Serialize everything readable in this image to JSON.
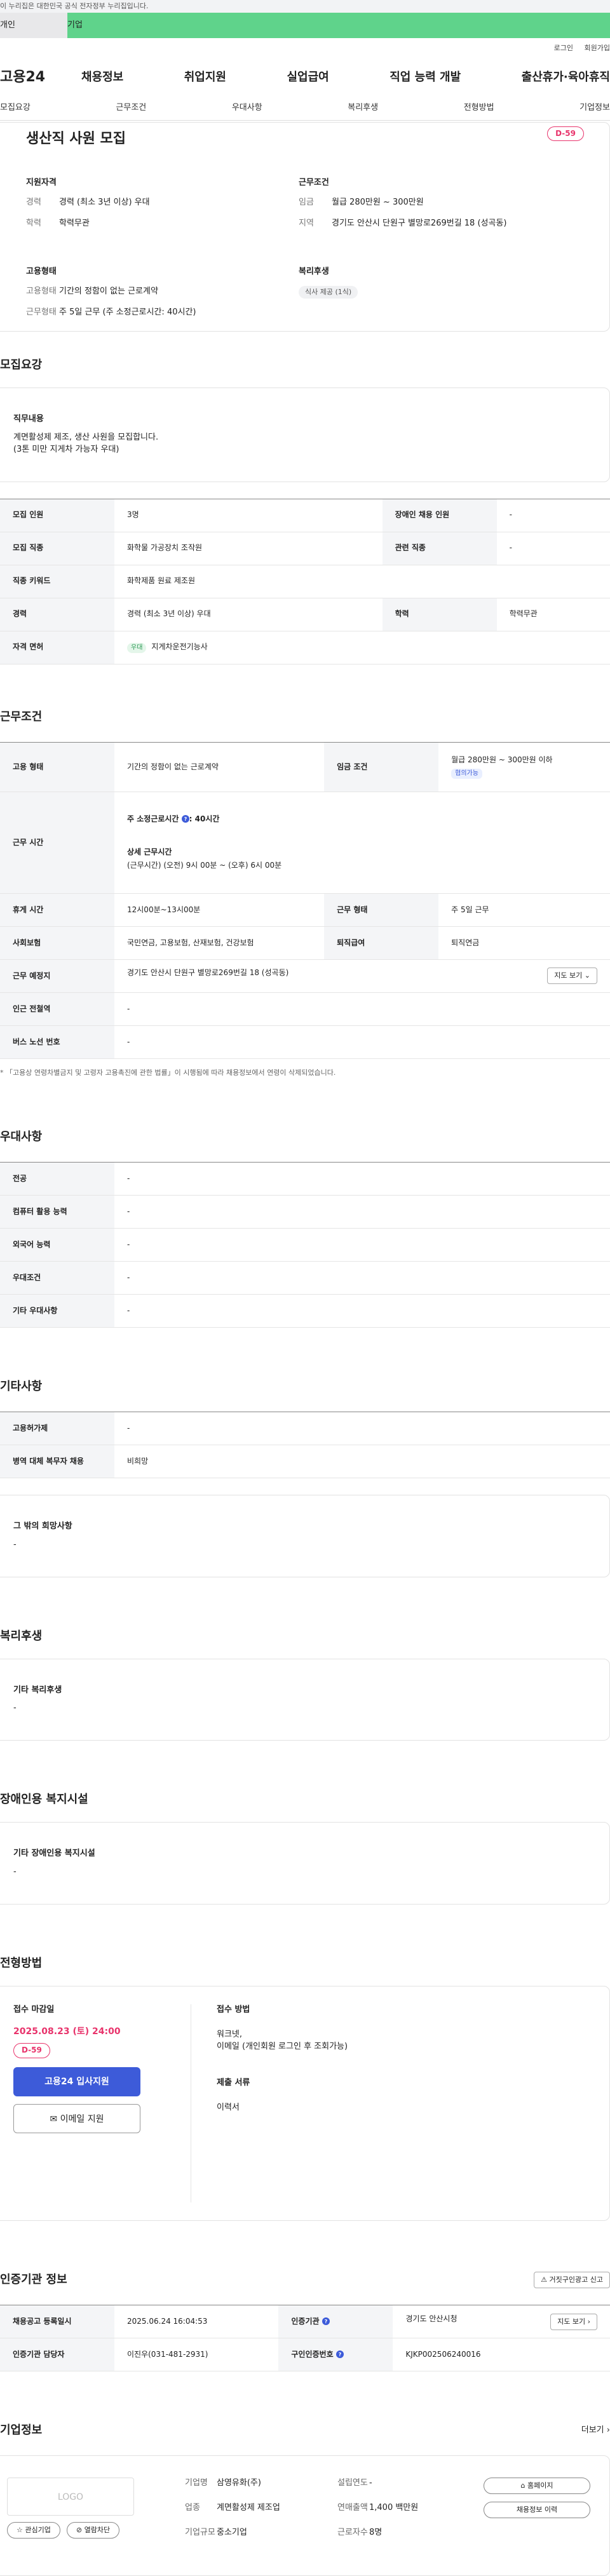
{
  "topbar": {
    "text": "이 누리집은 대한민국 공식 전자정부 누리집입니다."
  },
  "gnb_tabs": [
    "개인",
    "기업"
  ],
  "util": {
    "login": "로그인",
    "join": "회원가입"
  },
  "header": {
    "logo": "고용24",
    "nav": [
      "채용정보",
      "취업지원",
      "실업급여",
      "직업 능력 개발",
      "출산휴가·육아휴직"
    ]
  },
  "subnav": [
    "모집요강",
    "근무조건",
    "우대사항",
    "복리후생",
    "전형방법",
    "기업정보"
  ],
  "summary": {
    "title": "생산직 사원 모집",
    "dday": "D-59",
    "qual_h": "지원자격",
    "exp_k": "경력",
    "exp_v": "경력 (최소 3년 이상) 우대",
    "edu_k": "학력",
    "edu_v": "학력무관",
    "cond_h": "근무조건",
    "wage_k": "임금",
    "wage_v": "월급 280만원 ~ 300만원",
    "area_k": "지역",
    "area_v": "경기도 안산시 단원구 별망로269번길 18 (성곡동)",
    "emp_h": "고용형태",
    "emp_k1": "고용형태",
    "emp_v1": "기간의 정함이 없는 근로계약",
    "emp_k2": "근무형태",
    "emp_v2": "주 5일 근무 (주 소정근로시간: 40시간)",
    "wel_h": "복리후생",
    "wel_chip": "식사 제공 (1식)"
  },
  "recruit": {
    "section": "모집요강",
    "duty_h": "직무내용",
    "duty_1": "계면활성제 제조, 생산 사원을 모집합니다.",
    "duty_2": "(3톤 미만 지게차 가능자 우대)",
    "rows": {
      "count_k": "모집 인원",
      "count_v": "3명",
      "disab_k": "장애인 채용 인원",
      "disab_v": "-",
      "job_k": "모집 직종",
      "job_v": "화학물 가공장치 조작원",
      "rel_k": "관련 직종",
      "rel_v": "-",
      "kw_k": "직종 키워드",
      "kw_v": "화학제품 원료 제조원",
      "exp_k": "경력",
      "exp_v": "경력 (최소 3년 이상) 우대",
      "edu_k": "학력",
      "edu_v": "학력무관",
      "lic_k": "자격 면허",
      "lic_tag": "우대",
      "lic_v": "지게차운전기능사"
    }
  },
  "work": {
    "section": "근무조건",
    "type_k": "고용 형태",
    "type_v": "기간의 정함이 없는 근로계약",
    "wage_k": "임금 조건",
    "wage_v": "월급 280만원 ~ 300만원 이하",
    "wage_tag": "협의가능",
    "time_k": "근무 시간",
    "time_1": "주 소정근로시간",
    "time_1v": ": 40시간",
    "time_2": "상세 근무시간",
    "time_3": "(근무시간) (오전) 9시 00분 ~ (오후) 6시 00분",
    "rest_k": "휴게 시간",
    "rest_v": "12시00분~13시00분",
    "form_k": "근무 형태",
    "form_v": "주 5일 근무",
    "ins_k": "사회보험",
    "ins_v": "국민연금, 고용보험, 산재보험, 건강보험",
    "ret_k": "퇴직급여",
    "ret_v": "퇴직연금",
    "place_k": "근무 예정지",
    "place_v": "경기도 안산시 단원구 별망로269번길 18 (성곡동)",
    "map_btn": "지도 보기",
    "sub_k": "인근 전철역",
    "sub_v": "-",
    "bus_k": "버스 노선 번호",
    "bus_v": "-",
    "note": "* 「고용상 연령차별금지 및 고령자 고용촉진에 관한 법률」이 시행됨에 따라 채용정보에서 연령이 삭제되었습니다."
  },
  "pref": {
    "section": "우대사항",
    "rows": [
      {
        "k": "전공",
        "v": "-"
      },
      {
        "k": "컴퓨터 활용 능력",
        "v": "-"
      },
      {
        "k": "외국어 능력",
        "v": "-"
      },
      {
        "k": "우대조건",
        "v": "-"
      },
      {
        "k": "기타 우대사항",
        "v": "-"
      }
    ]
  },
  "etc": {
    "section": "기타사항",
    "rows": [
      {
        "k": "고용허가제",
        "v": "-"
      },
      {
        "k": "병역 대체 복무자 채용",
        "v": "비희망"
      }
    ],
    "wish_h": "그 밖의 희망사항",
    "wish_v": "-"
  },
  "welfare": {
    "section": "복리후생",
    "h": "기타 복리후생",
    "v": "-"
  },
  "disab": {
    "section": "장애인용 복지시설",
    "h": "기타 장애인용 복지시설",
    "v": "-"
  },
  "process": {
    "section": "전형방법",
    "dl_h": "접수 마감일",
    "dl_v": "2025.08.23 (토) 24:00",
    "dday": "D-59",
    "apply_btn": "고용24 입사지원",
    "email_btn": "이메일 지원",
    "method_h": "접수 방법",
    "method_1": "워크넷,",
    "method_2": "이메일 (개인회원 로그인 후 조회가능)",
    "doc_h": "제출 서류",
    "doc_v": "이력서"
  },
  "cert": {
    "section": "인증기관 정보",
    "report_btn": "거짓구인광고 신고",
    "reg_k": "채용공고 등록일시",
    "reg_v": "2025.06.24 16:04:53",
    "org_k": "인증기관",
    "org_v": "경기도 안산시청",
    "map_btn": "지도 보기",
    "mgr_k": "인증기관 담당자",
    "mgr_v": "이진우(031-481-2931)",
    "no_k": "구인인증번호",
    "no_v": "KJKP002506240016"
  },
  "company": {
    "section": "기업정보",
    "more": "더보기",
    "logo": "LOGO",
    "fav_btn": "관심기업",
    "block_btn": "열람차단",
    "name_k": "기업명",
    "name_v": "삼영유화(주)",
    "ind_k": "업종",
    "ind_v": "계면활성제 제조업",
    "size_k": "기업규모",
    "size_v": "중소기업",
    "year_k": "설립연도",
    "year_v": "-",
    "sales_k": "연매출액",
    "sales_v": "1,400 백만원",
    "emp_k": "근로자수",
    "emp_v": "8명",
    "home_btn": "홈페이지",
    "hist_btn": "채용정보 이력"
  }
}
